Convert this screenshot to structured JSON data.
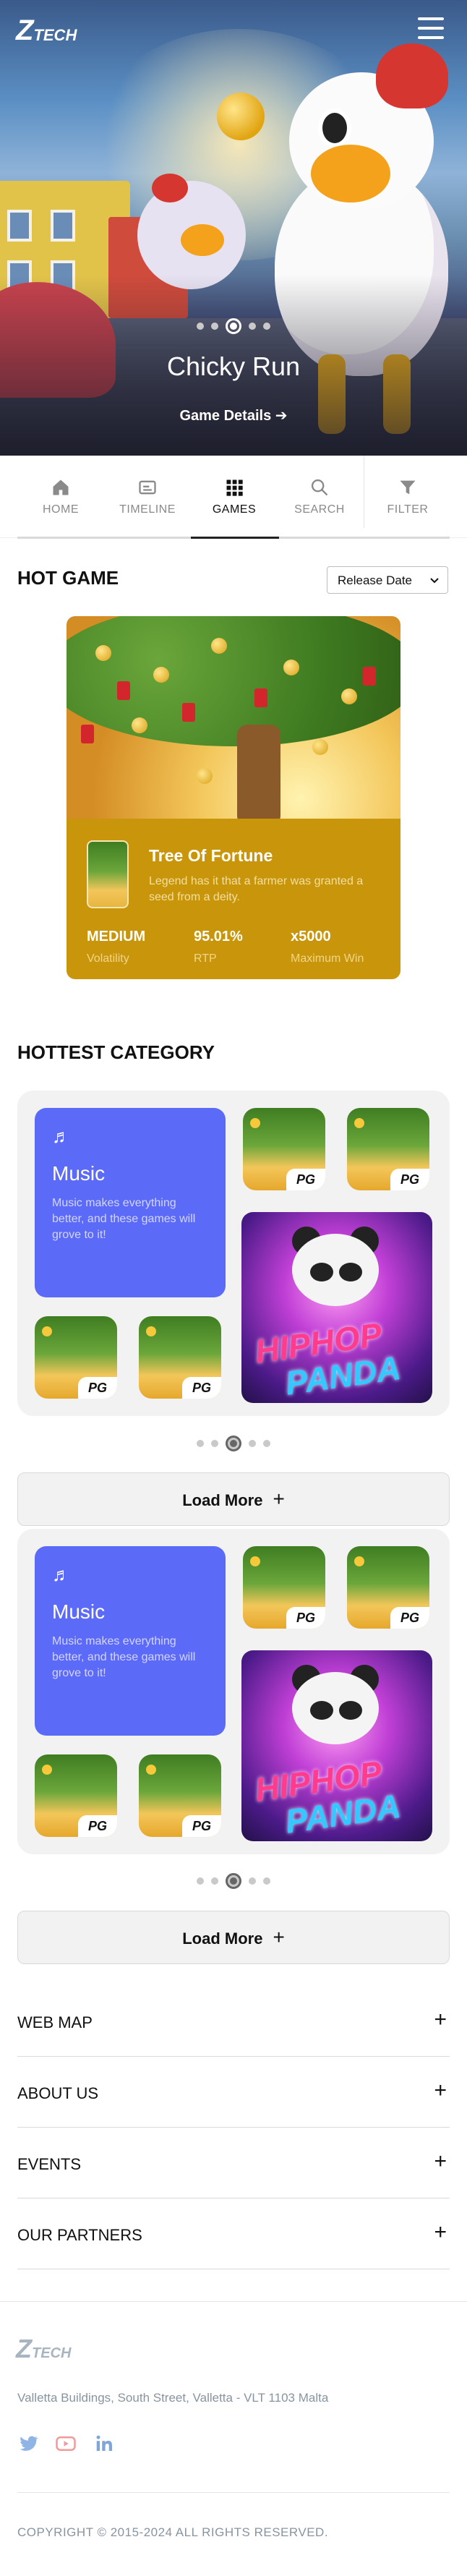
{
  "brand": {
    "logo_mark": "Z",
    "logo_word": "TECH"
  },
  "hero": {
    "title": "Chicky Run",
    "link": "Game Details ➔"
  },
  "nav": {
    "items": [
      {
        "label": "HOME",
        "icon": "home-icon"
      },
      {
        "label": "TIMELINE",
        "icon": "timeline-icon"
      },
      {
        "label": "GAMES",
        "icon": "games-grid-icon",
        "active": true
      },
      {
        "label": "SEARCH",
        "icon": "search-icon"
      },
      {
        "label": "FILTER",
        "icon": "filter-icon"
      }
    ]
  },
  "hot_game": {
    "title": "HOT GAME",
    "sort": {
      "selected": "Release Date"
    },
    "game": {
      "name": "Tree Of Fortune",
      "description": "Legend has it that a farmer was granted a seed from a deity.",
      "stats": [
        {
          "value": "MEDIUM",
          "label": "Volatility"
        },
        {
          "value": "95.01%",
          "label": "RTP"
        },
        {
          "value": "x5000",
          "label": "Maximum Win"
        }
      ]
    }
  },
  "hottest_category": {
    "title": "HOTTEST CATEGORY",
    "category": {
      "name": "Music",
      "description": "Music makes everything better, and these games will grove to it!"
    },
    "tile_badge": "PG",
    "panda_line1": "HIPHOP",
    "panda_line2": "PANDA",
    "load_more": "Load More"
  },
  "accordion": [
    {
      "label": "WEB MAP"
    },
    {
      "label": "ABOUT US"
    },
    {
      "label": "EVENTS"
    },
    {
      "label": "OUR PARTNERS"
    }
  ],
  "footer": {
    "logo_mark": "Z",
    "logo_word": "TECH",
    "address": "Valletta Buildings, South Street, Valletta - VLT 1103 Malta",
    "social": [
      "twitter-icon",
      "youtube-icon",
      "linkedin-icon"
    ],
    "copyright": "COPYRIGHT © 2015-2024 ALL RIGHTS RESERVED."
  },
  "colors": {
    "accent_category": "#5c6af8",
    "hot_info_bg": "#c8950b",
    "muted_text": "#8894a0"
  }
}
